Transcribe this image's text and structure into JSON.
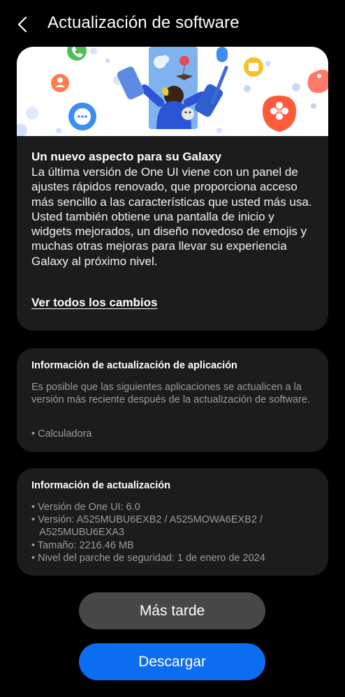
{
  "header": {
    "title": "Actualización de software",
    "back_icon": "chevron-left-icon"
  },
  "feature_card": {
    "banner_icons": [
      "phone-icon",
      "person-icon",
      "chat-bubble-icon",
      "flower-icon",
      "calendar-icon",
      "balloon-icon",
      "sun-icon",
      "dog-icon"
    ],
    "heading": "Un nuevo aspecto para su Galaxy",
    "body": "La última versión de One UI viene con un panel de ajustes rápidos renovado, que proporciona acceso más sencillo a las características que usted más usa. Usted también obtiene una pantalla de inicio y widgets mejorados, un diseño novedoso de emojis y muchas otras mejoras para llevar su experiencia Galaxy al próximo nivel.",
    "link": "Ver todos los cambios"
  },
  "app_update_card": {
    "title": "Información de actualización de aplicación",
    "description": "Es posible que las siguientes aplicaciones se actualicen a la versión más reciente después de la actualización de software.",
    "items": [
      "• Calculadora"
    ]
  },
  "update_info_card": {
    "title": "Información de actualización",
    "items": [
      "• Versión de One UI: 6.0",
      "• Versión: A525MUBU6EXB2 / A525MOWA6EXB2 /",
      "   A525MUBU6EXA3",
      "• Tamaño: 2216.46 MB",
      "• Nivel del parche de seguridad: 1 de enero de 2024"
    ]
  },
  "buttons": {
    "later": "Más tarde",
    "download": "Descargar"
  },
  "colors": {
    "background": "#000000",
    "card": "#1c1c1c",
    "secondary_text": "#9b9b9b",
    "later_button": "#474747",
    "download_button": "#0c6df0"
  }
}
